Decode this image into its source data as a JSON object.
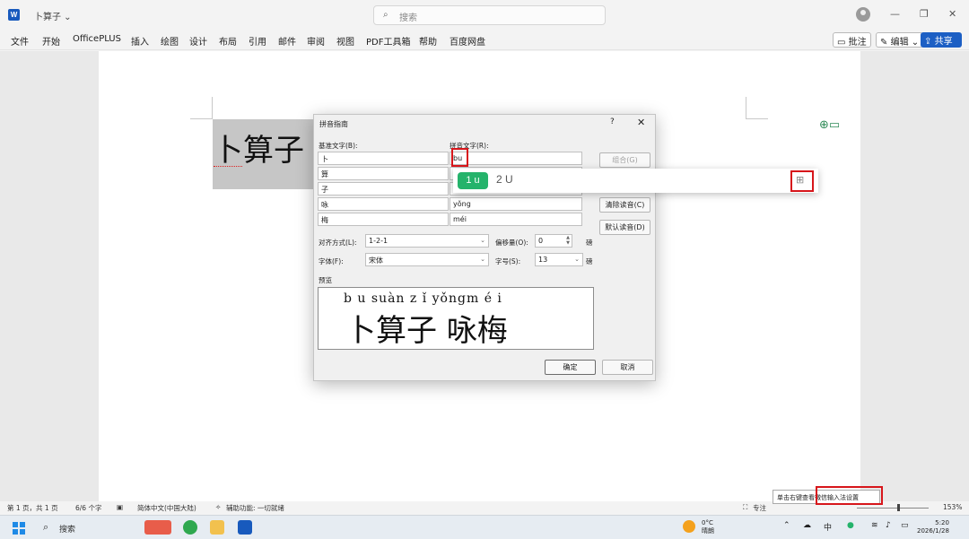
{
  "window": {
    "app_icon": "word-icon",
    "title": "卜算子",
    "search_placeholder": "搜索"
  },
  "ribbon": {
    "tabs": [
      "文件",
      "开始",
      "OfficePLUS",
      "插入",
      "绘图",
      "设计",
      "布局",
      "引用",
      "邮件",
      "审阅",
      "视图",
      "PDF工具箱",
      "帮助",
      "百度网盘"
    ],
    "comment_btn": "批注",
    "edit_btn": "编辑",
    "share_btn": "共享"
  },
  "document": {
    "heading": "卜算子"
  },
  "dialog": {
    "title": "拼音指南",
    "help": "?",
    "close": "✕",
    "base_label": "基准文字(B):",
    "ruby_label": "拼音文字(R):",
    "rows": [
      {
        "base": "卜",
        "ruby": "bu"
      },
      {
        "base": "算",
        "ruby": "su"
      },
      {
        "base": "子",
        "ruby": "zi"
      },
      {
        "base": "咏",
        "ruby": "yǒng"
      },
      {
        "base": "梅",
        "ruby": "méi"
      }
    ],
    "btn_combine": "组合(G)",
    "btn_clear": "清除读音(C)",
    "btn_default": "默认读音(D)",
    "align_label": "对齐方式(L):",
    "align_value": "1-2-1",
    "offset_label": "偏移量(O):",
    "offset_value": "0",
    "offset_unit": "磅",
    "font_label": "字体(F):",
    "font_value": "宋体",
    "size_label": "字号(S):",
    "size_value": "13",
    "size_unit": "磅",
    "preview_label": "预览",
    "preview_pinyin": "b u suàn z ǐ  yǒngm é i",
    "preview_text": "卜算子 咏梅",
    "ok": "确定",
    "cancel": "取消"
  },
  "ime": {
    "candidate_1": "1 u",
    "candidate_2": "2 U",
    "more_icon": "grid-icon"
  },
  "status": {
    "page": "第 1 页，共 1 页",
    "words": "6/6 个字",
    "language": "简体中文(中国大陆)",
    "accessibility": "辅助功能: 一切就绪",
    "focus": "专注",
    "zoom": "153%",
    "tooltip": "单击右键查看微信输入法设置"
  },
  "taskbar": {
    "search": "搜索",
    "temperature": "0°C",
    "weather": "晴朗",
    "ime_mode": "中",
    "time": "5:20",
    "date": "2026/1/28"
  },
  "colors": {
    "share_blue": "#1c5fc4",
    "ime_green": "#25b36b",
    "highlight_red": "#d7161b"
  }
}
